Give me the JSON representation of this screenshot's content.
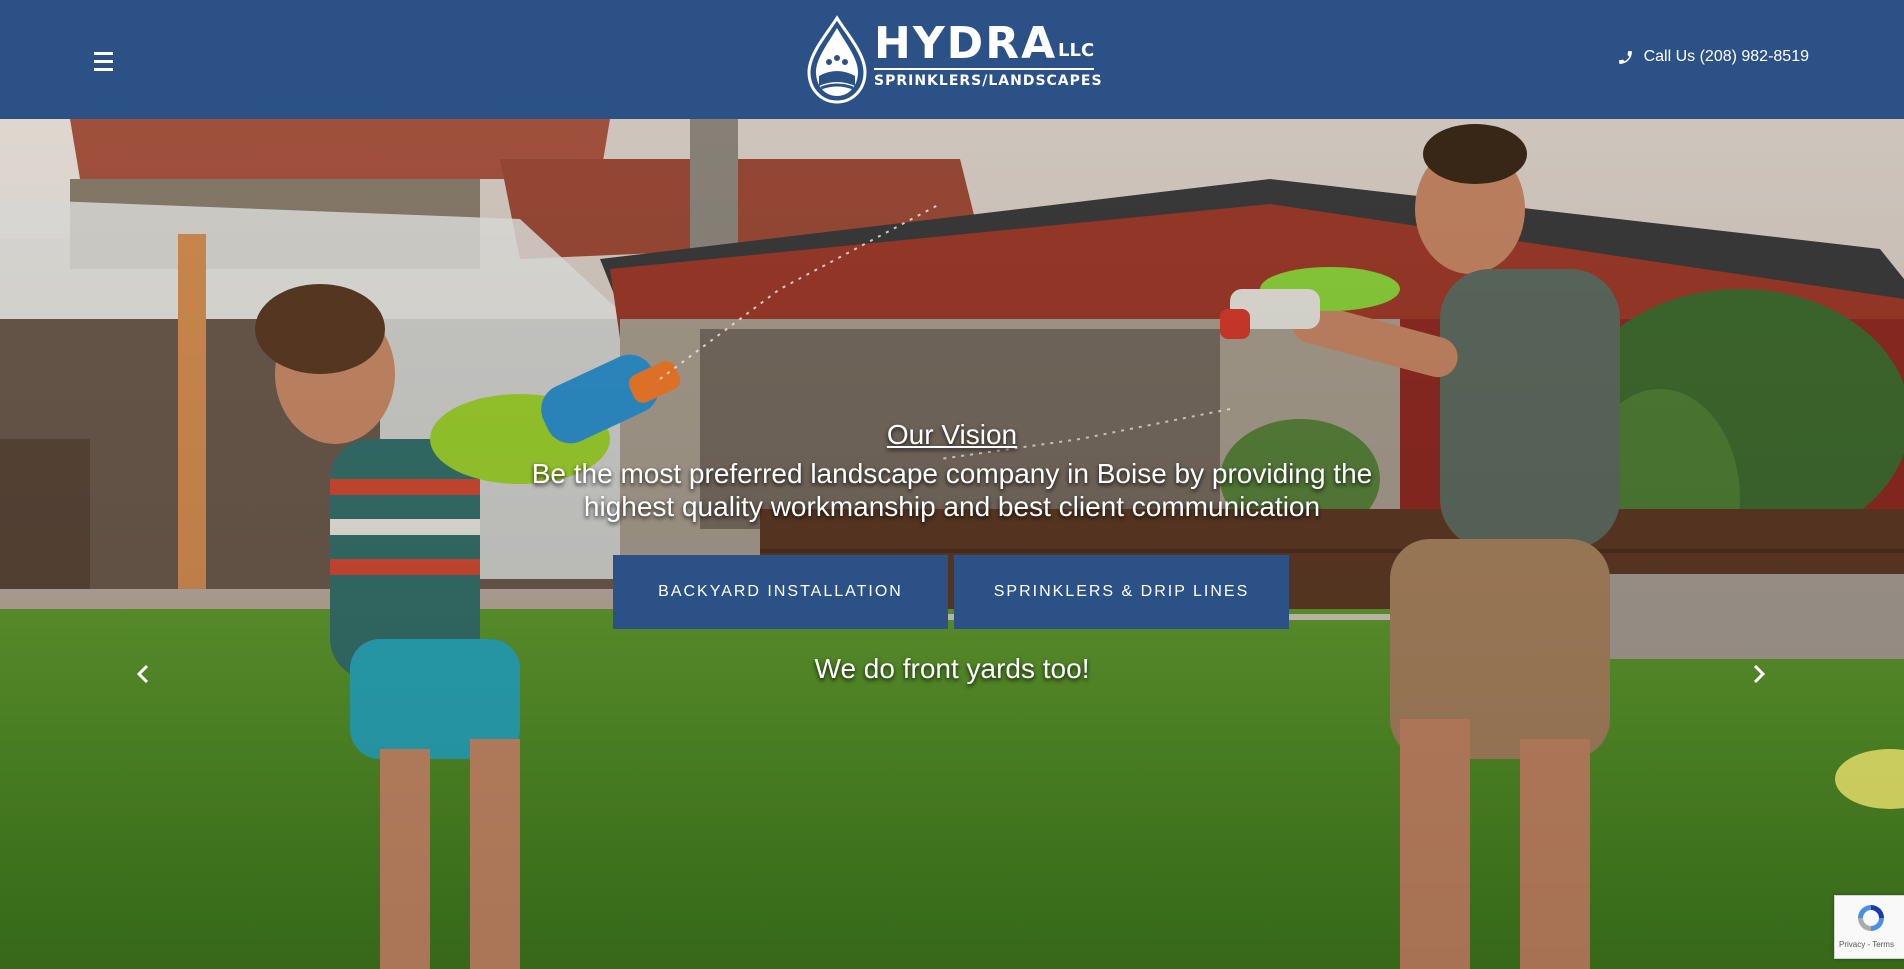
{
  "header": {
    "brand_name": "HYDRA",
    "brand_suffix": "LLC",
    "brand_tagline": "SPRINKLERS/LANDSCAPES",
    "phone_label": "Call Us (208) 982-8519",
    "menu_icon": "hamburger-menu-icon",
    "phone_icon": "phone-icon"
  },
  "hero": {
    "vision_title": "Our Vision",
    "vision_text": "Be the most preferred landscape company in Boise by providing the highest quality workmanship and best client communication",
    "buttons": [
      {
        "label": "BACKYARD INSTALLATION"
      },
      {
        "label": "SPRINKLERS & DRIP LINES"
      }
    ],
    "front_yards": "We do front yards too!",
    "prev_icon": "chevron-left-icon",
    "next_icon": "chevron-right-icon"
  },
  "recaptcha": {
    "links": "Privacy - Terms"
  },
  "colors": {
    "brand_blue": "#2c5186",
    "white": "#ffffff"
  }
}
